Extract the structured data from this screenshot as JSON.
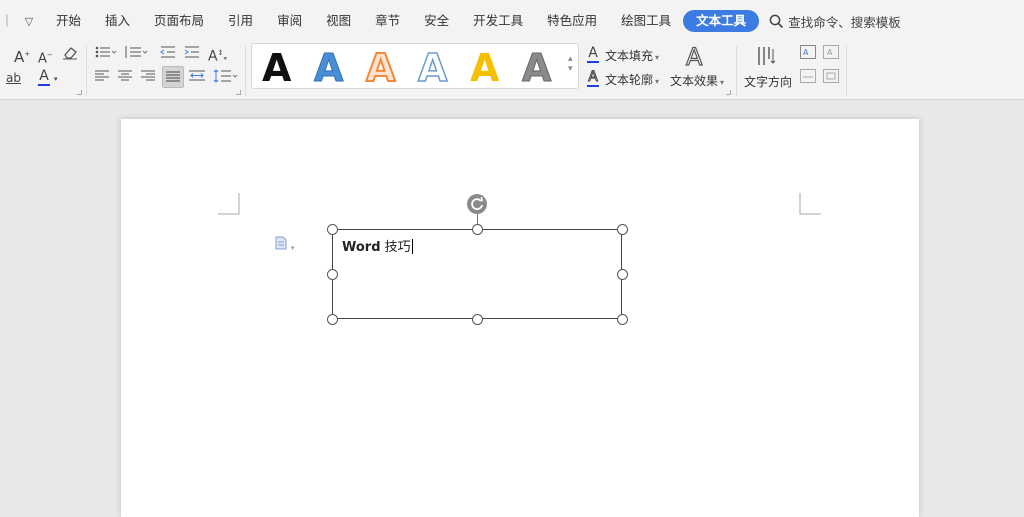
{
  "menu": {
    "items": [
      "开始",
      "插入",
      "页面布局",
      "引用",
      "审阅",
      "视图",
      "章节",
      "安全",
      "开发工具",
      "特色应用",
      "绘图工具",
      "文本工具"
    ],
    "active": "文本工具",
    "search_label": "查找命令、搜索模板"
  },
  "ribbon": {
    "text_fill": "文本填充",
    "text_outline": "文本轮廓",
    "text_effects": "文本效果",
    "text_direction": "文字方向",
    "gallery_letter": "A",
    "font_grow_glyph": "A",
    "font_shrink_glyph": "A",
    "font_color_glyph": "A",
    "highlight_glyph": "ab"
  },
  "colors": {
    "accent": "#3c7be2",
    "gallery_black": "#111111",
    "gallery_blue": "#4a8fd6",
    "gallery_orange": "#f08a3a",
    "gallery_outline_blue": "#6a9bd0",
    "gallery_yellow": "#f5c000",
    "gallery_gray": "#777777",
    "font_color_underline": "#1f3fe0"
  },
  "document": {
    "textbox_word": "Word",
    "textbox_rest": " 技巧"
  }
}
